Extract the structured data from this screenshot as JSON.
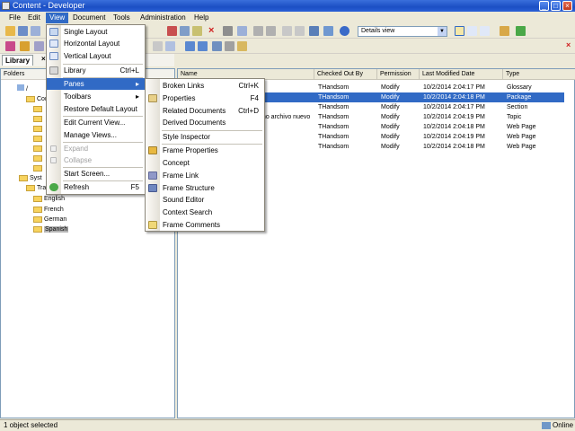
{
  "window": {
    "title": "Content - Developer"
  },
  "menubar": [
    "File",
    "Edit",
    "View",
    "Document",
    "Tools",
    "Administration",
    "Help"
  ],
  "toolbar": {
    "view_combo": "Details view"
  },
  "library_tab": {
    "label": "Library",
    "close": "×"
  },
  "folders_header": "Folders",
  "tree": {
    "root": "/",
    "con": "Con",
    "syst": "Syst",
    "tran": "Tran",
    "langs": [
      "English",
      "French",
      "German",
      "Spanish"
    ]
  },
  "columns": [
    "Name",
    "Checked Out By",
    "Permission",
    "Last Modified Date",
    "Type"
  ],
  "rows": [
    {
      "name": "",
      "checked": "THandsom",
      "perm": "Modify",
      "date": "10/2/2014 2:04:17 PM",
      "type": "Glossary"
    },
    {
      "name": "",
      "checked": "THandsom",
      "perm": "Modify",
      "date": "10/2/2014 2:04:18 PM",
      "type": "Package"
    },
    {
      "name": "",
      "checked": "THandsom",
      "perm": "Modify",
      "date": "10/2/2014 2:04:17 PM",
      "type": "Section"
    },
    {
      "name": "mo archivo nuevo",
      "checked": "THandsom",
      "perm": "Modify",
      "date": "10/2/2014 2:04:19 PM",
      "type": "Topic"
    },
    {
      "name": "",
      "checked": "THandsom",
      "perm": "Modify",
      "date": "10/2/2014 2:04:18 PM",
      "type": "Web Page"
    },
    {
      "name": "",
      "checked": "THandsom",
      "perm": "Modify",
      "date": "10/2/2014 2:04:19 PM",
      "type": "Web Page"
    },
    {
      "name": "",
      "checked": "THandsom",
      "perm": "Modify",
      "date": "10/2/2014 2:04:18 PM",
      "type": "Web Page"
    }
  ],
  "view_menu": {
    "single": "Single Layout",
    "horizontal": "Horizontal Layout",
    "vertical": "Vertical Layout",
    "library": "Library",
    "library_sc": "Ctrl+L",
    "panes": "Panes",
    "toolbars": "Toolbars",
    "restore": "Restore Default Layout",
    "edit_view": "Edit Current View...",
    "manage_views": "Manage Views...",
    "expand": "Expand",
    "collapse": "Collapse",
    "start_screen": "Start Screen...",
    "refresh": "Refresh",
    "refresh_sc": "F5"
  },
  "panes_menu": {
    "broken": "Broken Links",
    "broken_sc": "Ctrl+K",
    "properties": "Properties",
    "properties_sc": "F4",
    "related": "Related Documents",
    "related_sc": "Ctrl+D",
    "derived": "Derived Documents",
    "style": "Style Inspector",
    "frame_props": "Frame Properties",
    "concept": "Concept",
    "frame_link": "Frame Link",
    "frame_struct": "Frame Structure",
    "sound": "Sound Editor",
    "context": "Context Search",
    "comments": "Frame Comments"
  },
  "status": {
    "left": "1 object selected",
    "right": "Online"
  },
  "colors": {
    "accent": "#316AC5",
    "title": "#1B4FC4"
  }
}
